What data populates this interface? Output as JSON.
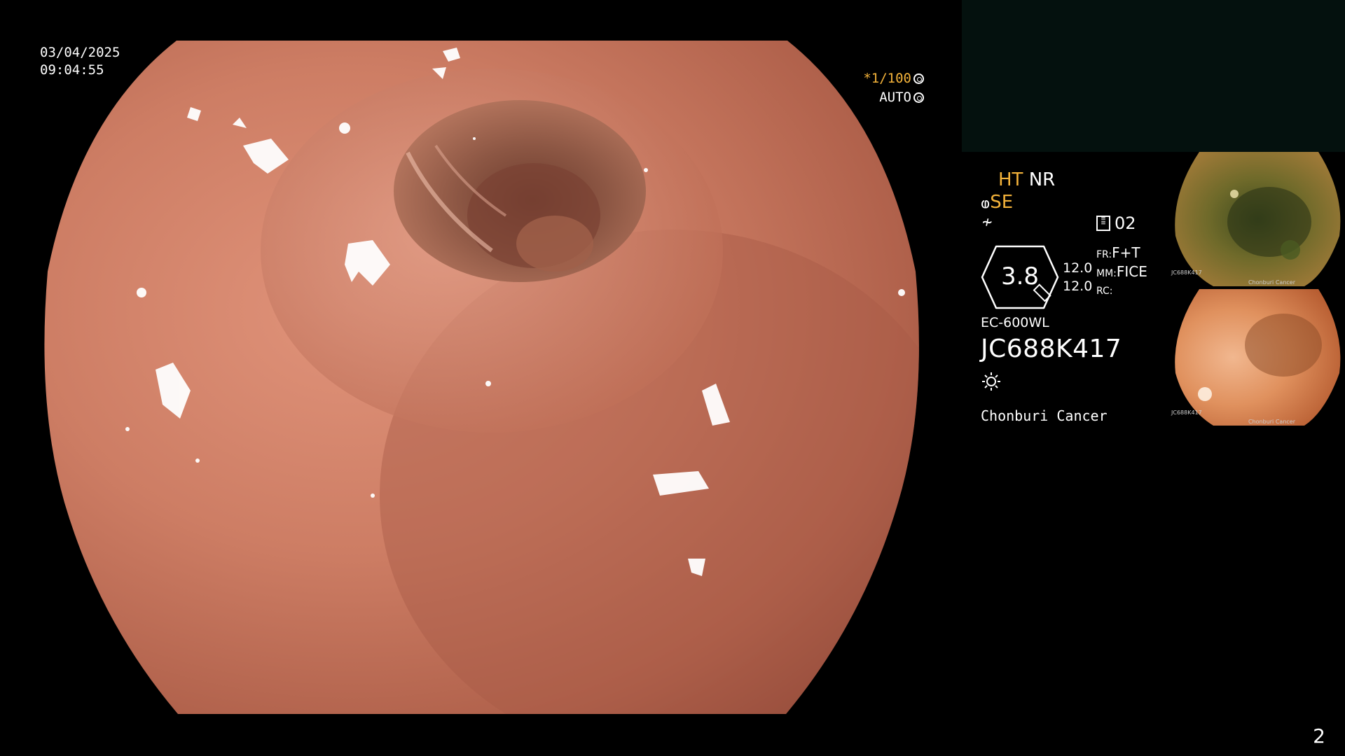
{
  "datetime": {
    "date": "03/04/2025",
    "time": "09:04:55"
  },
  "shutter": {
    "speed": "*1/100",
    "mode": "AUTO"
  },
  "settings": {
    "ht": "HT",
    "nr": "NR",
    "se": "SE",
    "mode_number": "02",
    "zoom_value": "3.8",
    "value1": "12.0",
    "value2": "12.0",
    "fr_label": "FR:",
    "fr_value": "F+T",
    "mm_label": "MM:",
    "mm_value": "FICE",
    "rc_label": "RC:"
  },
  "device": {
    "model": "EC-600WL",
    "serial": "JC688K417"
  },
  "hospital": "Chonburi Cancer",
  "thumbnails": [
    {
      "label": "JC688K417",
      "footer": "Chonburi Cancer"
    },
    {
      "label": "JC688K417",
      "footer": "Chonburi Cancer"
    }
  ],
  "page_number": "2",
  "colors": {
    "accent_yellow": "#f3b23a",
    "background": "#000000",
    "tissue": "#c97a5e"
  },
  "icons": {
    "shutter": "aperture-icon",
    "auto": "auto-iris-icon",
    "light": "sun-icon",
    "scope": "scope-icon",
    "freeze": "freeze-icon",
    "memory": "memory-card-icon"
  }
}
